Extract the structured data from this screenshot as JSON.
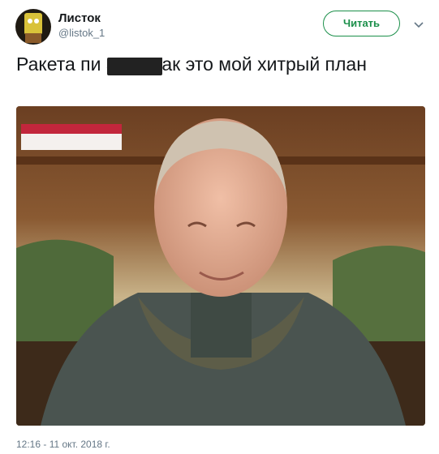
{
  "author": {
    "display_name": "Листок",
    "handle": "@listok_1"
  },
  "follow_button_label": "Читать",
  "tweet": {
    "text": "Ракета пи             ась? Так это мой хитрый план"
  },
  "timestamp": "12:16 - 11 окт. 2018 г.",
  "icons": {
    "more": "chevron-down-icon"
  },
  "colors": {
    "accent": "#1b8f4a",
    "secondary_text": "#657786"
  }
}
